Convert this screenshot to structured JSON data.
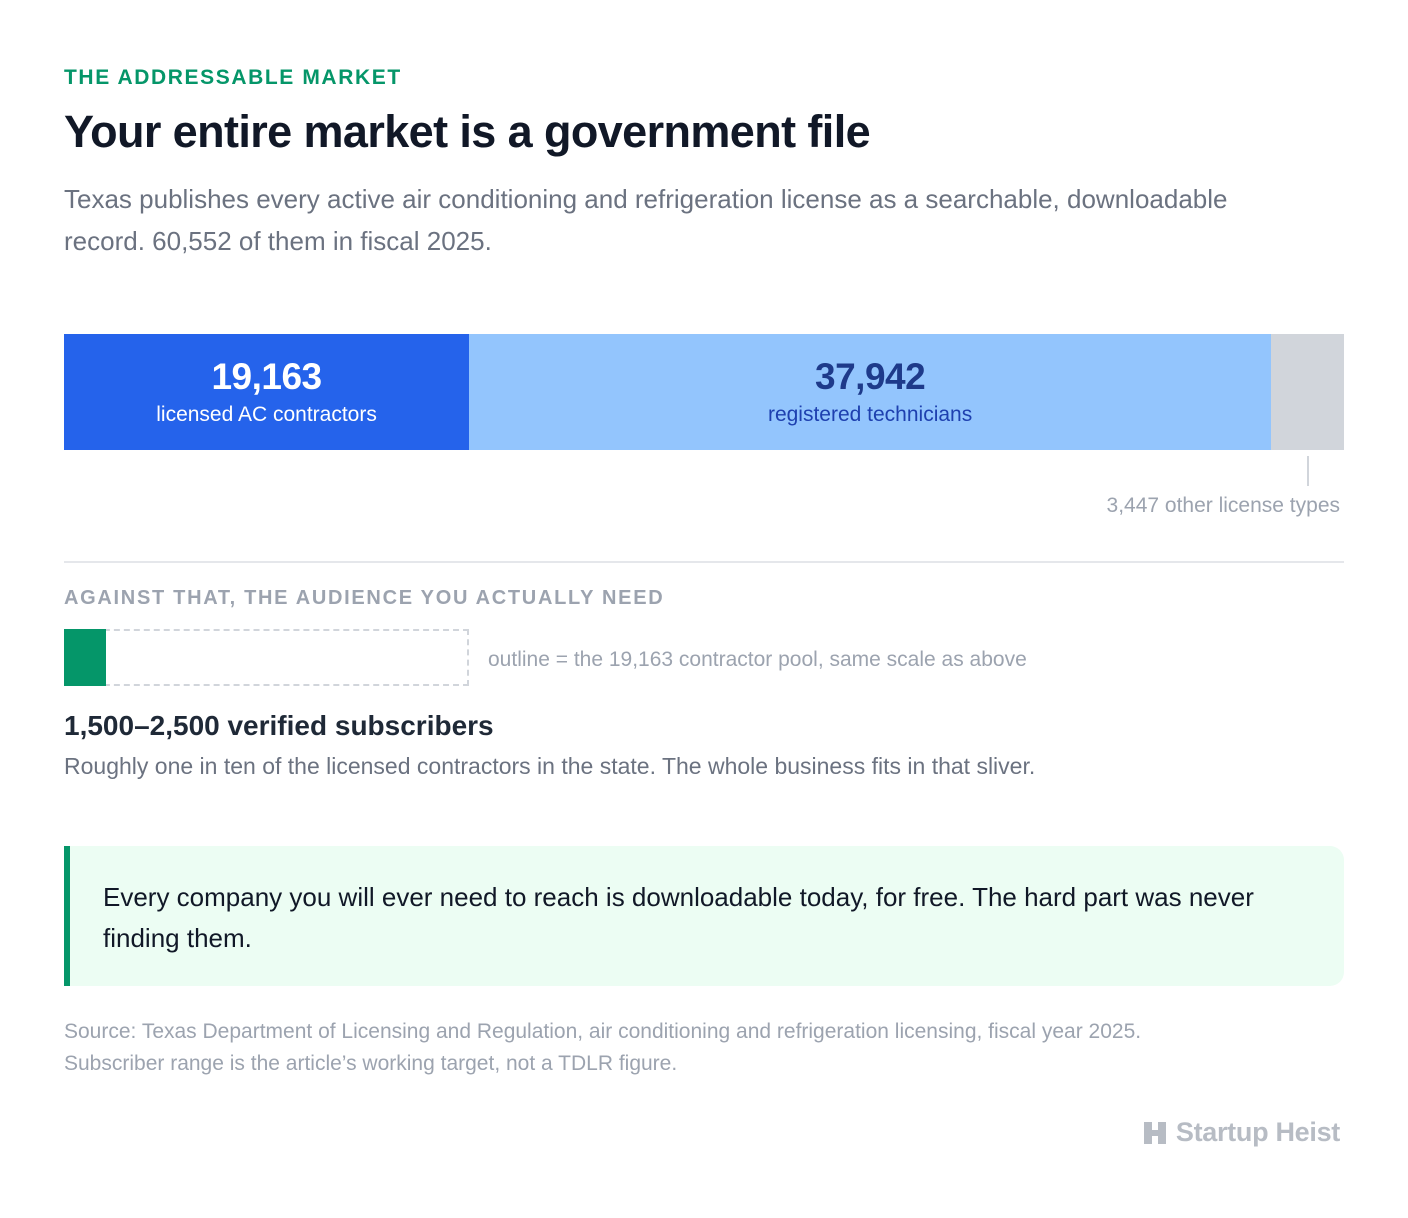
{
  "header": {
    "eyebrow": "THE ADDRESSABLE MARKET",
    "title": "Your entire market is a government file",
    "subtitle": "Texas publishes every active air conditioning and refrigeration license as a searchable, downloadable record. 60,552 of them in fiscal 2025."
  },
  "chart_data": [
    {
      "type": "bar",
      "orientation": "horizontal-stacked",
      "total": 60552,
      "segments": [
        {
          "value_label": "19,163",
          "value": 19163,
          "label": "licensed AC contractors"
        },
        {
          "value_label": "37,942",
          "value": 37942,
          "label": "registered technicians"
        },
        {
          "value_label": "",
          "value": 3447,
          "label": "3,447 other license types"
        }
      ]
    },
    {
      "type": "bar",
      "orientation": "horizontal",
      "pool_value": 19163,
      "target_range": [
        1500,
        2500
      ],
      "filled_value": 2000,
      "note": "outline = the 19,163 contractor pool, same scale as above"
    }
  ],
  "audience": {
    "eyebrow": "AGAINST THAT, THE AUDIENCE YOU ACTUALLY NEED",
    "headline": "1,500–2,500 verified subscribers",
    "description": "Roughly one in ten of the licensed contractors in the state. The whole business fits in that sliver."
  },
  "callout": {
    "text": "Every company you will ever need to reach is downloadable today, for free. The hard part was never finding them."
  },
  "source": {
    "line1": "Source: Texas Department of Licensing and Regulation, air conditioning and refrigeration licensing, fiscal year 2025.",
    "line2": "Subscriber range is the article’s working target, not a TDLR figure."
  },
  "brand": {
    "name": "Startup Heist",
    "icon": "building-logo-icon"
  },
  "colors": {
    "accent_green": "#059669",
    "contractors": "#2563eb",
    "technicians": "#93c5fd",
    "other": "#d1d5db"
  }
}
